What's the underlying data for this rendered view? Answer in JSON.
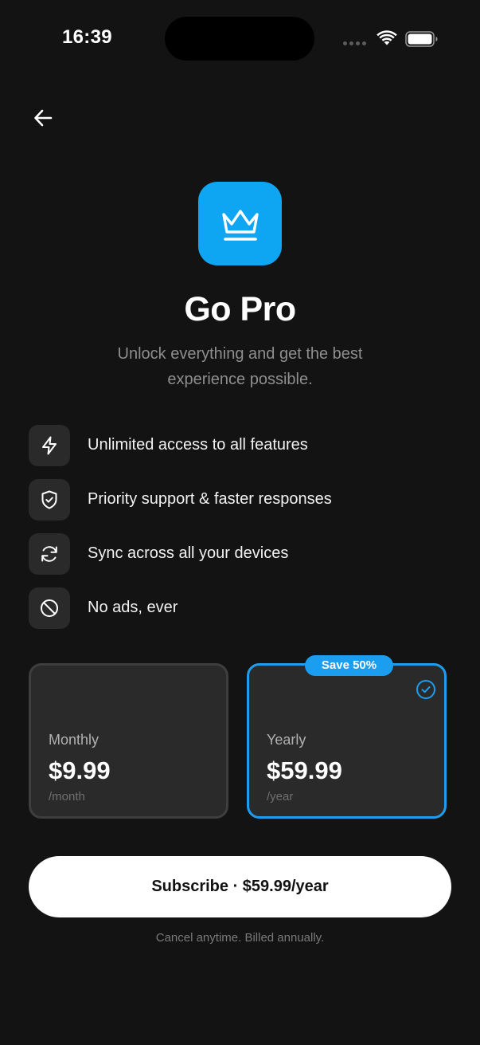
{
  "status_bar": {
    "time": "16:39"
  },
  "header": {
    "back_icon": "arrow-left-icon"
  },
  "hero": {
    "icon": "crown-icon",
    "accent_color": "#0EA5F2",
    "title": "Go Pro",
    "subtitle": "Unlock everything and get the best experience possible."
  },
  "features": [
    {
      "icon": "lightning-icon",
      "label": "Unlimited access to all features"
    },
    {
      "icon": "shield-check-icon",
      "label": "Priority support & faster responses"
    },
    {
      "icon": "sync-icon",
      "label": "Sync across all your devices"
    },
    {
      "icon": "no-ads-icon",
      "label": "No ads, ever"
    }
  ],
  "plans": {
    "monthly": {
      "name": "Monthly",
      "price": "$9.99",
      "period": "/month",
      "selected": false
    },
    "yearly": {
      "name": "Yearly",
      "price": "$59.99",
      "period": "/year",
      "badge": "Save 50%",
      "selected": true
    }
  },
  "cta": {
    "subscribe_label": "Subscribe · $59.99/year",
    "fine_print": "Cancel anytime. Billed annually."
  }
}
